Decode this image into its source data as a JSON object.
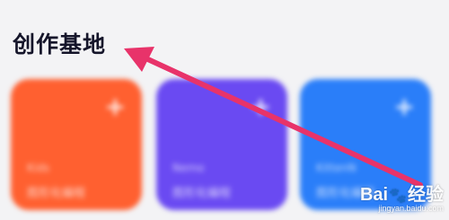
{
  "header": {
    "title": "创作基地"
  },
  "cards": [
    {
      "label": "Kids",
      "subtitle": "图形化编程",
      "plus": "+",
      "color": "#ff6030"
    },
    {
      "label": "Nemo",
      "subtitle": "图形化编程",
      "plus": "+",
      "color": "#6a4af2"
    },
    {
      "label": "KittenN",
      "subtitle": "图形化编程",
      "plus": "+",
      "color": "#2a7ef9"
    }
  ],
  "annotation": {
    "arrow_color": "#e8336a"
  },
  "watermark": {
    "brand_a": "Bai",
    "paw": "🐾",
    "brand_b": "经验",
    "url": "jingyan.baidu.com"
  }
}
